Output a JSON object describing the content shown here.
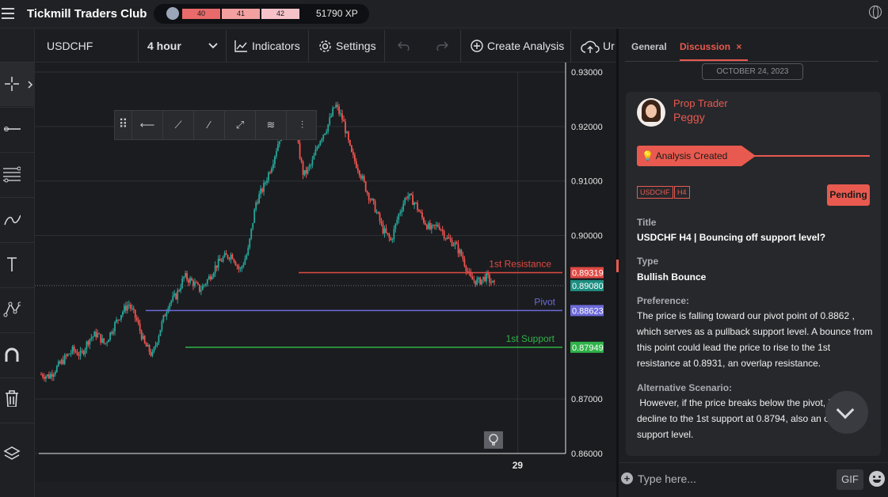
{
  "topbar": {
    "brand": "Tickmill Traders Club",
    "levels": [
      "40",
      "41",
      "42"
    ],
    "xp": "51790 XP",
    "level_progress": 0.6
  },
  "toolbar": {
    "symbol": "USDCHF",
    "timeframe": "4 hour",
    "indicators": "Indicators",
    "settings": "Settings",
    "create_analysis": "Create Analysis",
    "upload_partial": "Ur"
  },
  "left_tools": [
    "crosshair-icon",
    "trend-line-icon",
    "fib-levels-icon",
    "brush-icon",
    "text-icon",
    "pattern-icon",
    "magnet-icon",
    "trash-icon",
    "layers-icon"
  ],
  "draw_tools": [
    "drag-handle-icon",
    "ray-icon",
    "segment-icon",
    "line-icon",
    "extended-line-icon",
    "parallel-channel-icon",
    "fib-channel-icon"
  ],
  "chart_data": {
    "type": "candlestick",
    "symbol": "USDCHF",
    "timeframe": "4 hour",
    "ylim": [
      0.86,
      0.93
    ],
    "y_ticks": [
      "0.93000",
      "0.92000",
      "0.91000",
      "0.90000",
      "0.87000",
      "0.86000"
    ],
    "x_ticks": [
      "29"
    ],
    "x_tick_pos": 0.91,
    "current_price": "0.89080",
    "current_price_value": 0.8908,
    "close_path": [
      0.8745,
      0.8742,
      0.8758,
      0.8775,
      0.879,
      0.878,
      0.881,
      0.882,
      0.88,
      0.883,
      0.8856,
      0.8875,
      0.8845,
      0.88,
      0.878,
      0.883,
      0.8875,
      0.889,
      0.8925,
      0.8915,
      0.89,
      0.892,
      0.8945,
      0.896,
      0.8965,
      0.8935,
      0.897,
      0.906,
      0.909,
      0.913,
      0.918,
      0.9215,
      0.919,
      0.911,
      0.913,
      0.9175,
      0.92,
      0.924,
      0.921,
      0.915,
      0.912,
      0.908,
      0.905,
      0.901,
      0.899,
      0.904,
      0.9075,
      0.906,
      0.903,
      0.901,
      0.902,
      0.8995,
      0.8985,
      0.896,
      0.892,
      0.8915,
      0.8925,
      0.8908
    ],
    "levels": [
      {
        "label": "1st Resistance",
        "value": 0.89319,
        "value_text": "0.89319",
        "color": "#e04a44"
      },
      {
        "label": "Pivot",
        "value": 0.88623,
        "value_text": "0.88623",
        "color": "#6d6ad9"
      },
      {
        "label": "1st Support",
        "value": 0.87949,
        "value_text": "0.87949",
        "color": "#2fb34a"
      }
    ],
    "colors": {
      "up": "#26a69a",
      "down": "#ef5350",
      "grid": "#2f3035",
      "axis": "#e6e6e6"
    }
  },
  "panel": {
    "tab_general": "General",
    "tab_discussion": "Discussion",
    "tab_close": "×",
    "date": "OCTOBER 24, 2023",
    "author_role": "Prop Trader",
    "author_name": "Peggy",
    "banner": "Analysis Created",
    "tags": [
      "USDCHF",
      "H4"
    ],
    "status": "Pending",
    "title_label": "Title",
    "title_value": "USDCHF H4 | Bouncing off support level?",
    "type_label": "Type",
    "type_value": "Bullish Bounce",
    "preference_label": "Preference:",
    "preference_text": "The price is falling toward our pivot point of 0.8862 , which serves as a pullback support level. A bounce from this point could lead the price to rise to the 1st resistance at 0.8931, an overlap resistance.",
    "alt_label": "Alternative Scenario:",
    "alt_text": " However, if the price breaks below the pivot, it could decline to the 1st support at 0.8794, also an overlap support level.",
    "composer_placeholder": "Type here...",
    "gif": "GIF"
  },
  "colors": {
    "accent": "#e85a4f",
    "bg": "#1e1f22"
  }
}
